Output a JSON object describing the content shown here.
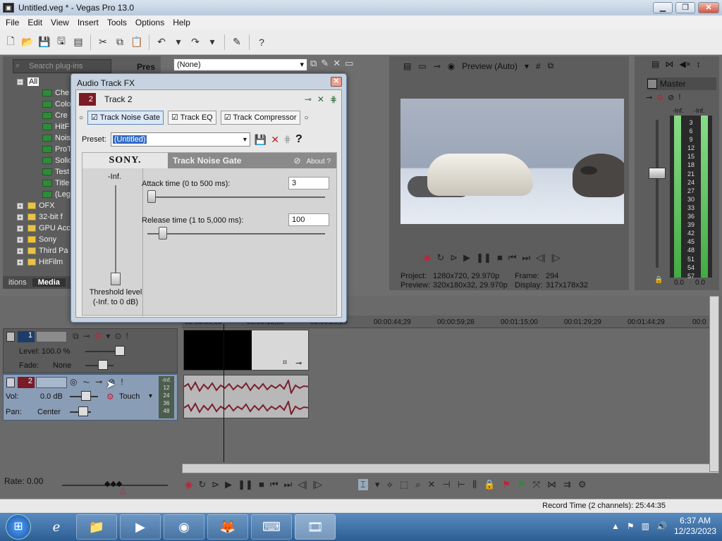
{
  "window": {
    "title": "Untitled.veg * - Vegas Pro 13.0",
    "app_icon": "vegas-icon",
    "min": "▁",
    "max": "❐",
    "close": "✕"
  },
  "menu": [
    "File",
    "Edit",
    "View",
    "Insert",
    "Tools",
    "Options",
    "Help"
  ],
  "explorer": {
    "search_placeholder": "Search plug-ins",
    "header_short": "Pres",
    "tree": [
      {
        "label": "All",
        "type": "root"
      },
      {
        "label": "Che",
        "type": "fx"
      },
      {
        "label": "Colo",
        "type": "fx"
      },
      {
        "label": "Cre",
        "type": "fx"
      },
      {
        "label": "HitF",
        "type": "fx"
      },
      {
        "label": "Nois",
        "type": "fx"
      },
      {
        "label": "ProT",
        "type": "fx"
      },
      {
        "label": "Solic",
        "type": "fx"
      },
      {
        "label": "Test",
        "type": "fx"
      },
      {
        "label": "Title",
        "type": "fx"
      },
      {
        "label": "(Leg",
        "type": "fx"
      },
      {
        "label": "OFX",
        "type": "folder"
      },
      {
        "label": "32-bit f",
        "type": "folder"
      },
      {
        "label": "GPU Acc",
        "type": "folder"
      },
      {
        "label": "Sony",
        "type": "folder"
      },
      {
        "label": "Third Pa",
        "type": "folder"
      },
      {
        "label": "HitFilm",
        "type": "folder"
      }
    ],
    "tabs": [
      "itions",
      "Media"
    ]
  },
  "fx_dropdown": {
    "value": "(None)"
  },
  "preview": {
    "mode": "Preview (Auto)",
    "project_label": "Project:",
    "project_value": "1280x720, 29.970p",
    "preview_label": "Preview:",
    "preview_value": "320x180x32, 29.970p",
    "frame_label": "Frame:",
    "frame_value": "294",
    "display_label": "Display:",
    "display_value": "317x178x32"
  },
  "master": {
    "title": "Master",
    "left_level": "-Inf.",
    "right_level": "-Inf.",
    "left_db": "0.0",
    "right_db": "0.0",
    "scale": [
      "3",
      "6",
      "9",
      "12",
      "15",
      "18",
      "21",
      "24",
      "27",
      "30",
      "33",
      "36",
      "39",
      "42",
      "45",
      "48",
      "51",
      "54",
      "57"
    ]
  },
  "timeline": {
    "ruler": [
      "00:00:00;00",
      "00:00:15;00",
      "00:00:29;29",
      "00:00:44;29",
      "00:00:59;28",
      "00:01:15;00",
      "00:01:29;29",
      "00:01:44;29",
      "00:0"
    ],
    "track1": {
      "num": "1",
      "level_label": "Level:",
      "level_value": "100.0 %",
      "fade_label": "Fade:",
      "fade_value": "None"
    },
    "track2": {
      "num": "2",
      "vol_label": "Vol:",
      "vol_value": "0.0 dB",
      "pan_label": "Pan:",
      "pan_value": "Center",
      "automation": "Touch",
      "meter_top": "-Inf.",
      "meter_scale": [
        "12",
        "24",
        "36",
        "48"
      ]
    },
    "rate": "Rate: 0.00"
  },
  "status": {
    "record_time": "Record Time (2 channels): 25:44:35"
  },
  "dialog": {
    "title": "Audio Track FX",
    "close": "✕",
    "track_num": "2",
    "track_name": "Track 2",
    "chain": [
      "Track Noise Gate",
      "Track EQ",
      "Track Compressor"
    ],
    "preset_label": "Preset:",
    "preset_value": "(Untitled)",
    "help": "?",
    "brand": "SONY.",
    "plugin_name": "Track Noise Gate",
    "about": "About",
    "about_q": "?",
    "threshold_top": "-Inf.",
    "threshold_label_1": "Threshold level",
    "threshold_label_2": "(-Inf. to 0 dB)",
    "attack_label": "Attack time (0 to 500 ms):",
    "attack_value": "3",
    "release_label": "Release time (1 to 5,000 ms):",
    "release_value": "100"
  },
  "taskbar": {
    "apps": [
      "file-explorer-icon",
      "internet-explorer-icon",
      "media-player-icon",
      "chrome-icon",
      "firefox-icon",
      "keyboard-app-icon",
      "vegas-pro-icon"
    ],
    "time": "6:37 AM",
    "date": "12/23/2023"
  }
}
